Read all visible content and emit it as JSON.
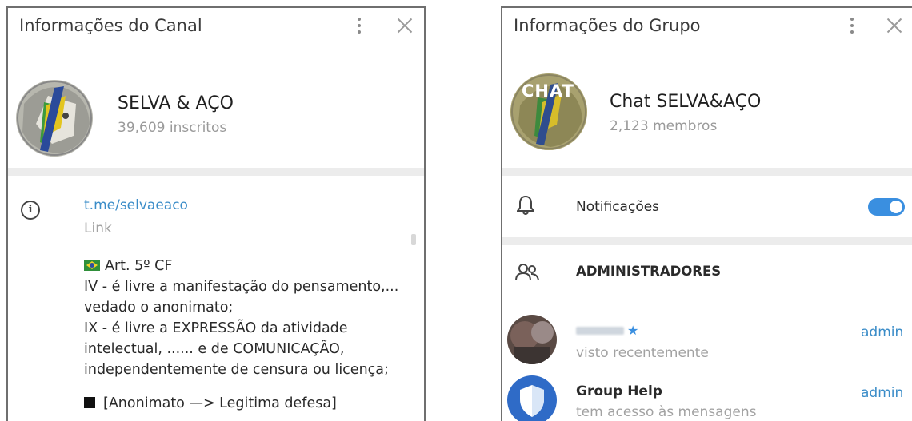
{
  "channel_panel": {
    "title": "Informações do Canal",
    "name": "SELVA & AÇO",
    "subscribers": "39,609 inscritos",
    "link": "t.me/selvaeaco",
    "link_label": "Link",
    "description": [
      "Art. 5º CF",
      "IV - é livre a manifestação do pensamento,...",
      "vedado o anonimato;",
      "IX - é livre a EXPRESSÃO da atividade",
      "intelectual, ...... e de COMUNICAÇÃO,",
      "independentemente de censura ou licença;",
      "",
      "[Anonimato —> Legitima defesa]"
    ]
  },
  "group_panel": {
    "title": "Informações do Grupo",
    "name": "Chat SELVA&AÇO",
    "members": "2,123 membros",
    "avatar_overlay": "CHAT",
    "notifications_label": "Notificações",
    "notifications_on": true,
    "admins_header": "ADMINISTRADORES",
    "admins": [
      {
        "status": "visto recentemente",
        "role": "admin"
      },
      {
        "name": "Group Help",
        "status": "tem acesso às mensagens",
        "role": "admin"
      }
    ]
  },
  "icons": {
    "menu": "kebab-icon",
    "close": "close-icon",
    "info": "info-icon",
    "bell": "bell-icon",
    "people": "people-icon",
    "star": "star-icon",
    "shield": "shield-icon"
  },
  "colors": {
    "accent": "#3a8cc8",
    "toggle": "#3a8fe0"
  }
}
